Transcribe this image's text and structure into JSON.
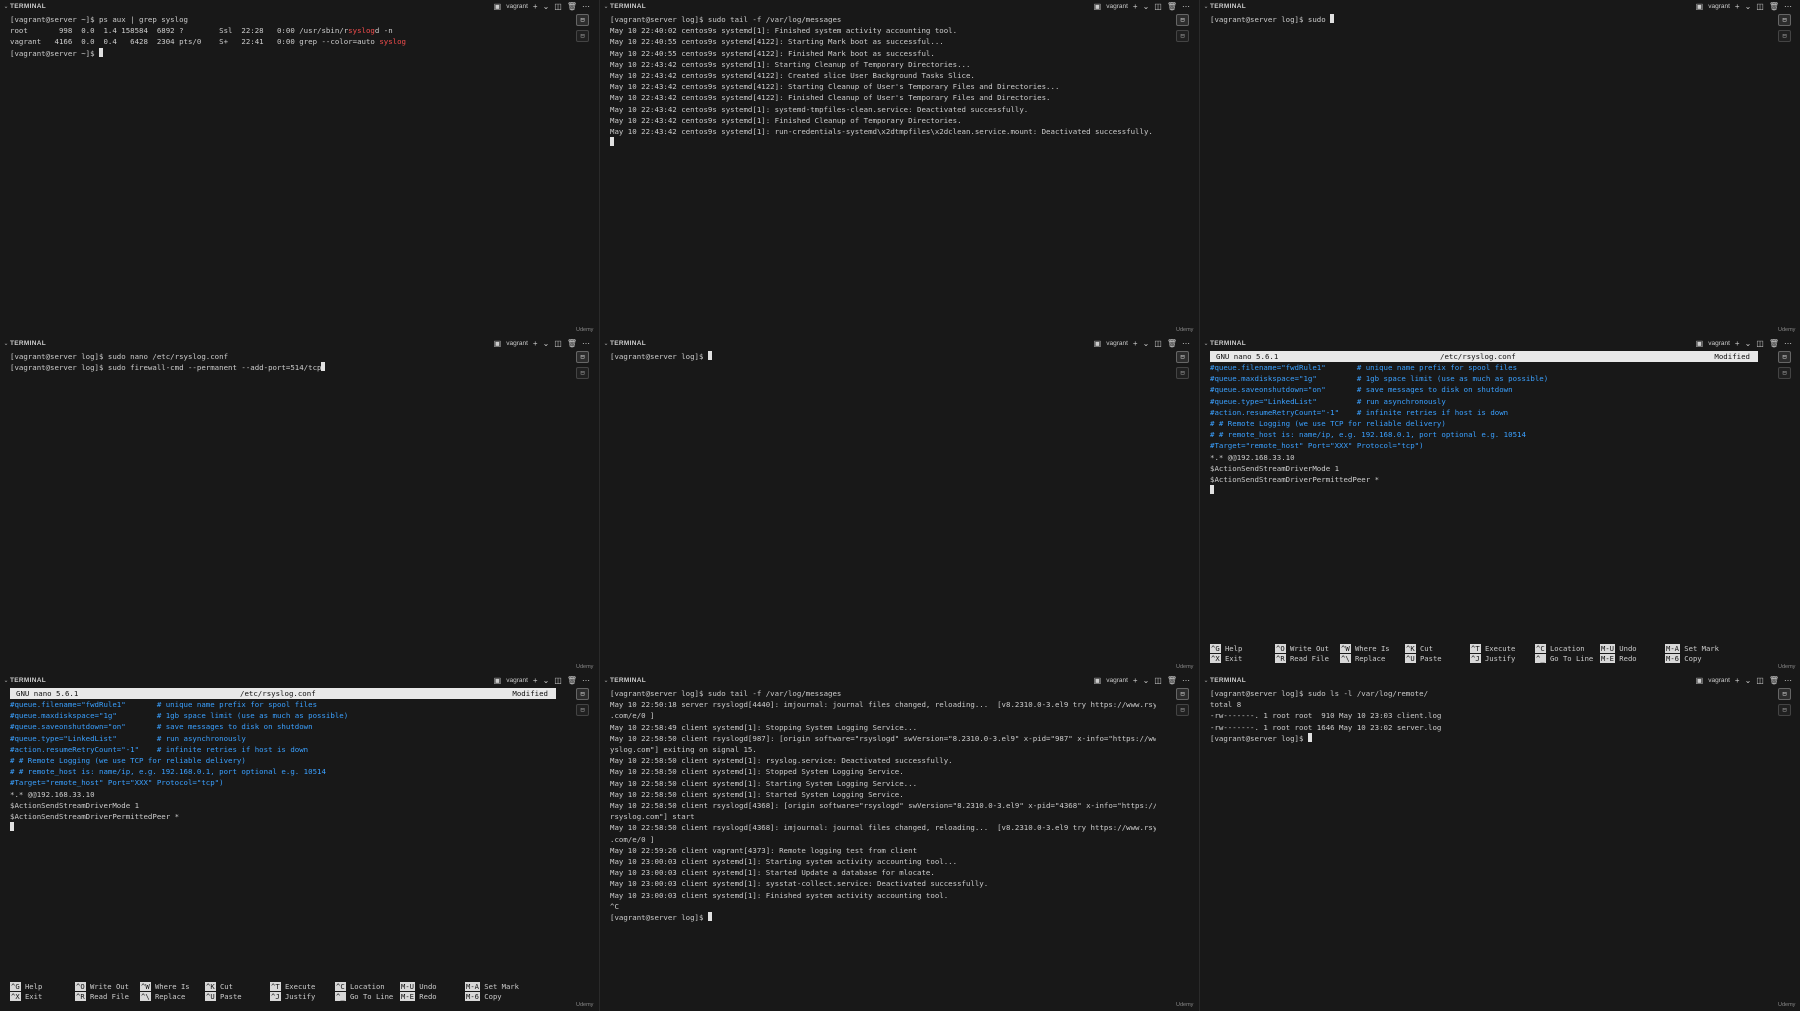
{
  "panes": [
    {
      "title": "TERMINAL",
      "shell": "vagrant",
      "brand": "Udemy",
      "kind": "plain",
      "lines": [
        "[vagrant@server ~]$ ps aux | grep syslog",
        "root       998  0.0  1.4 158584  6892 ?        Ssl  22:28   0:00 /usr/sbin/rsyslogd -n",
        "vagrant   4166  0.0  0.4   6428  2304 pts/0    S+   22:41   0:00 grep --color=auto syslog",
        "[vagrant@server ~]$ "
      ]
    },
    {
      "title": "TERMINAL",
      "shell": "vagrant",
      "brand": "Udemy",
      "kind": "plain",
      "lines": [
        "[vagrant@server log]$ sudo tail -f /var/log/messages",
        "May 10 22:40:02 centos9s systemd[1]: Finished system activity accounting tool.",
        "May 10 22:40:55 centos9s systemd[4122]: Starting Mark boot as successful...",
        "May 10 22:40:55 centos9s systemd[4122]: Finished Mark boot as successful.",
        "May 10 22:43:42 centos9s systemd[1]: Starting Cleanup of Temporary Directories...",
        "May 10 22:43:42 centos9s systemd[4122]: Created slice User Background Tasks Slice.",
        "May 10 22:43:42 centos9s systemd[4122]: Starting Cleanup of User's Temporary Files and Directories...",
        "May 10 22:43:42 centos9s systemd[4122]: Finished Cleanup of User's Temporary Files and Directories.",
        "May 10 22:43:42 centos9s systemd[1]: systemd-tmpfiles-clean.service: Deactivated successfully.",
        "May 10 22:43:42 centos9s systemd[1]: Finished Cleanup of Temporary Directories.",
        "May 10 22:43:42 centos9s systemd[1]: run-credentials-systemd\\x2dtmpfiles\\x2dclean.service.mount: Deactivated successfully.",
        ""
      ]
    },
    {
      "title": "TERMINAL",
      "shell": "vagrant",
      "brand": "Udemy",
      "kind": "plain",
      "lines": [
        "[vagrant@server log]$ sudo "
      ]
    },
    {
      "title": "TERMINAL",
      "shell": "vagrant",
      "brand": "Udemy",
      "kind": "plain",
      "lines": [
        "[vagrant@server log]$ sudo nano /etc/rsyslog.conf",
        "[vagrant@server log]$ sudo firewall-cmd --permanent --add-port=514/tcp"
      ]
    },
    {
      "title": "TERMINAL",
      "shell": "vagrant",
      "brand": "Udemy",
      "kind": "plain",
      "lines": [
        "[vagrant@server log]$ "
      ]
    },
    {
      "title": "TERMINAL",
      "shell": "vagrant",
      "brand": "Udemy",
      "kind": "nano",
      "nano": {
        "version": "GNU nano 5.6.1",
        "file": "/etc/rsyslog.conf",
        "status": "Modified",
        "lines": [
          {
            "text": "#queue.filename=\"fwdRule1\"       # unique name prefix for spool files",
            "cls": "cyan"
          },
          {
            "text": "#queue.maxdiskspace=\"1g\"         # 1gb space limit (use as much as possible)",
            "cls": "cyan"
          },
          {
            "text": "#queue.saveonshutdown=\"on\"       # save messages to disk on shutdown",
            "cls": "cyan"
          },
          {
            "text": "#queue.type=\"LinkedList\"         # run asynchronously",
            "cls": "cyan"
          },
          {
            "text": "#action.resumeRetryCount=\"-1\"    # infinite retries if host is down",
            "cls": "cyan"
          },
          {
            "text": "# # Remote Logging (we use TCP for reliable delivery)",
            "cls": "cyan"
          },
          {
            "text": "# # remote_host is: name/ip, e.g. 192.168.0.1, port optional e.g. 10514",
            "cls": "cyan"
          },
          {
            "text": "#Target=\"remote_host\" Port=\"XXX\" Protocol=\"tcp\")",
            "cls": "cyan"
          },
          {
            "text": "*.* @@192.168.33.10",
            "cls": ""
          },
          {
            "text": "$ActionSendStreamDriverMode 1",
            "cls": ""
          },
          {
            "text": "$ActionSendStreamDriverPermittedPeer *",
            "cls": ""
          }
        ],
        "help": [
          {
            "k1": "^G",
            "l1": "Help",
            "k2": "^X",
            "l2": "Exit"
          },
          {
            "k1": "^O",
            "l1": "Write Out",
            "k2": "^R",
            "l2": "Read File"
          },
          {
            "k1": "^W",
            "l1": "Where Is",
            "k2": "^\\",
            "l2": "Replace"
          },
          {
            "k1": "^K",
            "l1": "Cut",
            "k2": "^U",
            "l2": "Paste"
          },
          {
            "k1": "^T",
            "l1": "Execute",
            "k2": "^J",
            "l2": "Justify"
          },
          {
            "k1": "^C",
            "l1": "Location",
            "k2": "^_",
            "l2": "Go To Line"
          },
          {
            "k1": "M-U",
            "l1": "Undo",
            "k2": "M-E",
            "l2": "Redo"
          },
          {
            "k1": "M-A",
            "l1": "Set Mark",
            "k2": "M-6",
            "l2": "Copy"
          }
        ]
      }
    },
    {
      "title": "TERMINAL",
      "shell": "vagrant",
      "brand": "Udemy",
      "kind": "nano",
      "nano": {
        "version": "GNU nano 5.6.1",
        "file": "/etc/rsyslog.conf",
        "status": "Modified",
        "lines": [
          {
            "text": "#queue.filename=\"fwdRule1\"       # unique name prefix for spool files",
            "cls": "cyan"
          },
          {
            "text": "#queue.maxdiskspace=\"1g\"         # 1gb space limit (use as much as possible)",
            "cls": "cyan"
          },
          {
            "text": "#queue.saveonshutdown=\"on\"       # save messages to disk on shutdown",
            "cls": "cyan"
          },
          {
            "text": "#queue.type=\"LinkedList\"         # run asynchronously",
            "cls": "cyan"
          },
          {
            "text": "#action.resumeRetryCount=\"-1\"    # infinite retries if host is down",
            "cls": "cyan"
          },
          {
            "text": "# # Remote Logging (we use TCP for reliable delivery)",
            "cls": "cyan"
          },
          {
            "text": "# # remote_host is: name/ip, e.g. 192.168.0.1, port optional e.g. 10514",
            "cls": "cyan"
          },
          {
            "text": "#Target=\"remote_host\" Port=\"XXX\" Protocol=\"tcp\")",
            "cls": "cyan"
          },
          {
            "text": "*.* @@192.168.33.10",
            "cls": ""
          },
          {
            "text": "$ActionSendStreamDriverMode 1",
            "cls": ""
          },
          {
            "text": "$ActionSendStreamDriverPermittedPeer *",
            "cls": ""
          }
        ],
        "help": [
          {
            "k1": "^G",
            "l1": "Help",
            "k2": "^X",
            "l2": "Exit"
          },
          {
            "k1": "^O",
            "l1": "Write Out",
            "k2": "^R",
            "l2": "Read File"
          },
          {
            "k1": "^W",
            "l1": "Where Is",
            "k2": "^\\",
            "l2": "Replace"
          },
          {
            "k1": "^K",
            "l1": "Cut",
            "k2": "^U",
            "l2": "Paste"
          },
          {
            "k1": "^T",
            "l1": "Execute",
            "k2": "^J",
            "l2": "Justify"
          },
          {
            "k1": "^C",
            "l1": "Location",
            "k2": "^_",
            "l2": "Go To Line"
          },
          {
            "k1": "M-U",
            "l1": "Undo",
            "k2": "M-E",
            "l2": "Redo"
          },
          {
            "k1": "M-A",
            "l1": "Set Mark",
            "k2": "M-6",
            "l2": "Copy"
          }
        ]
      }
    },
    {
      "title": "TERMINAL",
      "shell": "vagrant",
      "brand": "Udemy",
      "kind": "plain",
      "lines": [
        "[vagrant@server log]$ sudo tail -f /var/log/messages",
        "May 10 22:50:18 server rsyslogd[4440]: imjournal: journal files changed, reloading...  [v8.2310.0-3.el9 try https://www.rsyslog",
        ".com/e/0 ]",
        "May 10 22:58:49 client systemd[1]: Stopping System Logging Service...",
        "May 10 22:58:50 client rsyslogd[987]: [origin software=\"rsyslogd\" swVersion=\"8.2310.0-3.el9\" x-pid=\"987\" x-info=\"https://www.rs",
        "yslog.com\"] exiting on signal 15.",
        "May 10 22:58:50 client systemd[1]: rsyslog.service: Deactivated successfully.",
        "May 10 22:58:50 client systemd[1]: Stopped System Logging Service.",
        "May 10 22:58:50 client systemd[1]: Starting System Logging Service...",
        "May 10 22:58:50 client systemd[1]: Started System Logging Service.",
        "May 10 22:58:50 client rsyslogd[4368]: [origin software=\"rsyslogd\" swVersion=\"8.2310.0-3.el9\" x-pid=\"4368\" x-info=\"https://www.",
        "rsyslog.com\"] start",
        "May 10 22:58:50 client rsyslogd[4368]: imjournal: journal files changed, reloading...  [v8.2310.0-3.el9 try https://www.rsyslog",
        ".com/e/0 ]",
        "May 10 22:59:26 client vagrant[4373]: Remote logging test from client",
        "May 10 23:00:03 client systemd[1]: Starting system activity accounting tool...",
        "May 10 23:00:03 client systemd[1]: Started Update a database for mlocate.",
        "May 10 23:00:03 client systemd[1]: sysstat-collect.service: Deactivated successfully.",
        "May 10 23:00:03 client systemd[1]: Finished system activity accounting tool.",
        "^C",
        "[vagrant@server log]$ "
      ]
    },
    {
      "title": "TERMINAL",
      "shell": "vagrant",
      "brand": "Udemy",
      "kind": "plain",
      "lines": [
        "[vagrant@server log]$ sudo ls -l /var/log/remote/",
        "total 8",
        "-rw-------. 1 root root  910 May 10 23:03 client.log",
        "-rw-------. 1 root root 1646 May 10 23:02 server.log",
        "[vagrant@server log]$ "
      ]
    }
  ]
}
